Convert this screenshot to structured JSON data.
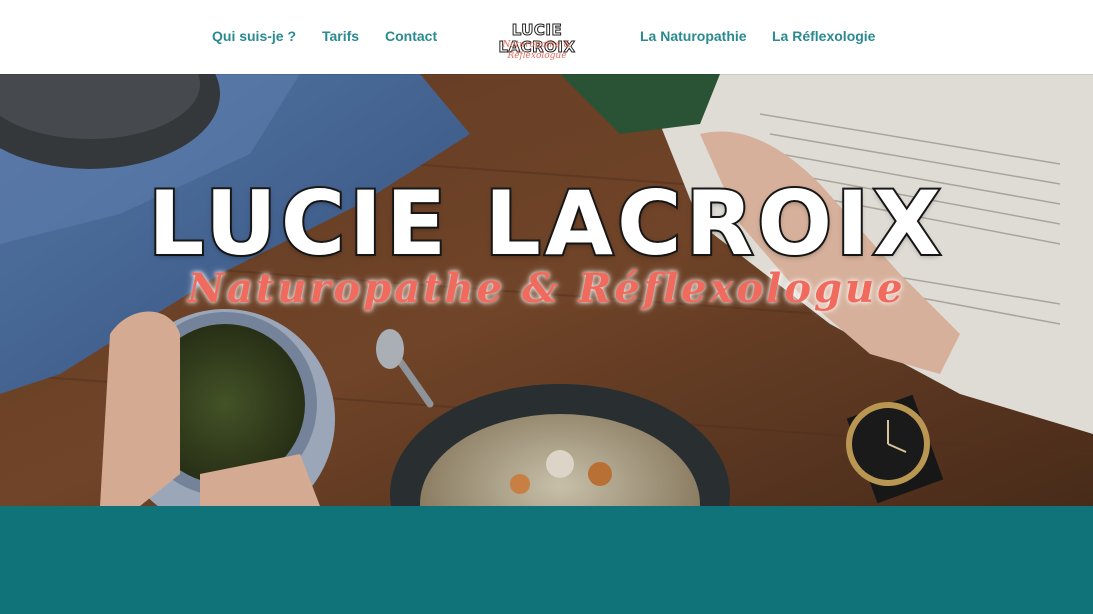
{
  "nav": {
    "left_items": [
      {
        "label": "Qui suis-je ?"
      },
      {
        "label": "Tarifs"
      },
      {
        "label": "Contact"
      }
    ],
    "right_items": [
      {
        "label": "La Naturopathie"
      },
      {
        "label": "La Réflexologie"
      }
    ],
    "link_color": "#2a8a90"
  },
  "logo": {
    "name": "LUCIE LACROIX",
    "subtitle": "Naturopathe & Réflexologue"
  },
  "hero": {
    "title": "LUCIE LACROIX",
    "subtitle": "Naturopathe & Réflexologue",
    "title_color": "#ffffff",
    "subtitle_color": "#f06a5e"
  },
  "footer_band": {
    "color": "#11737a"
  }
}
